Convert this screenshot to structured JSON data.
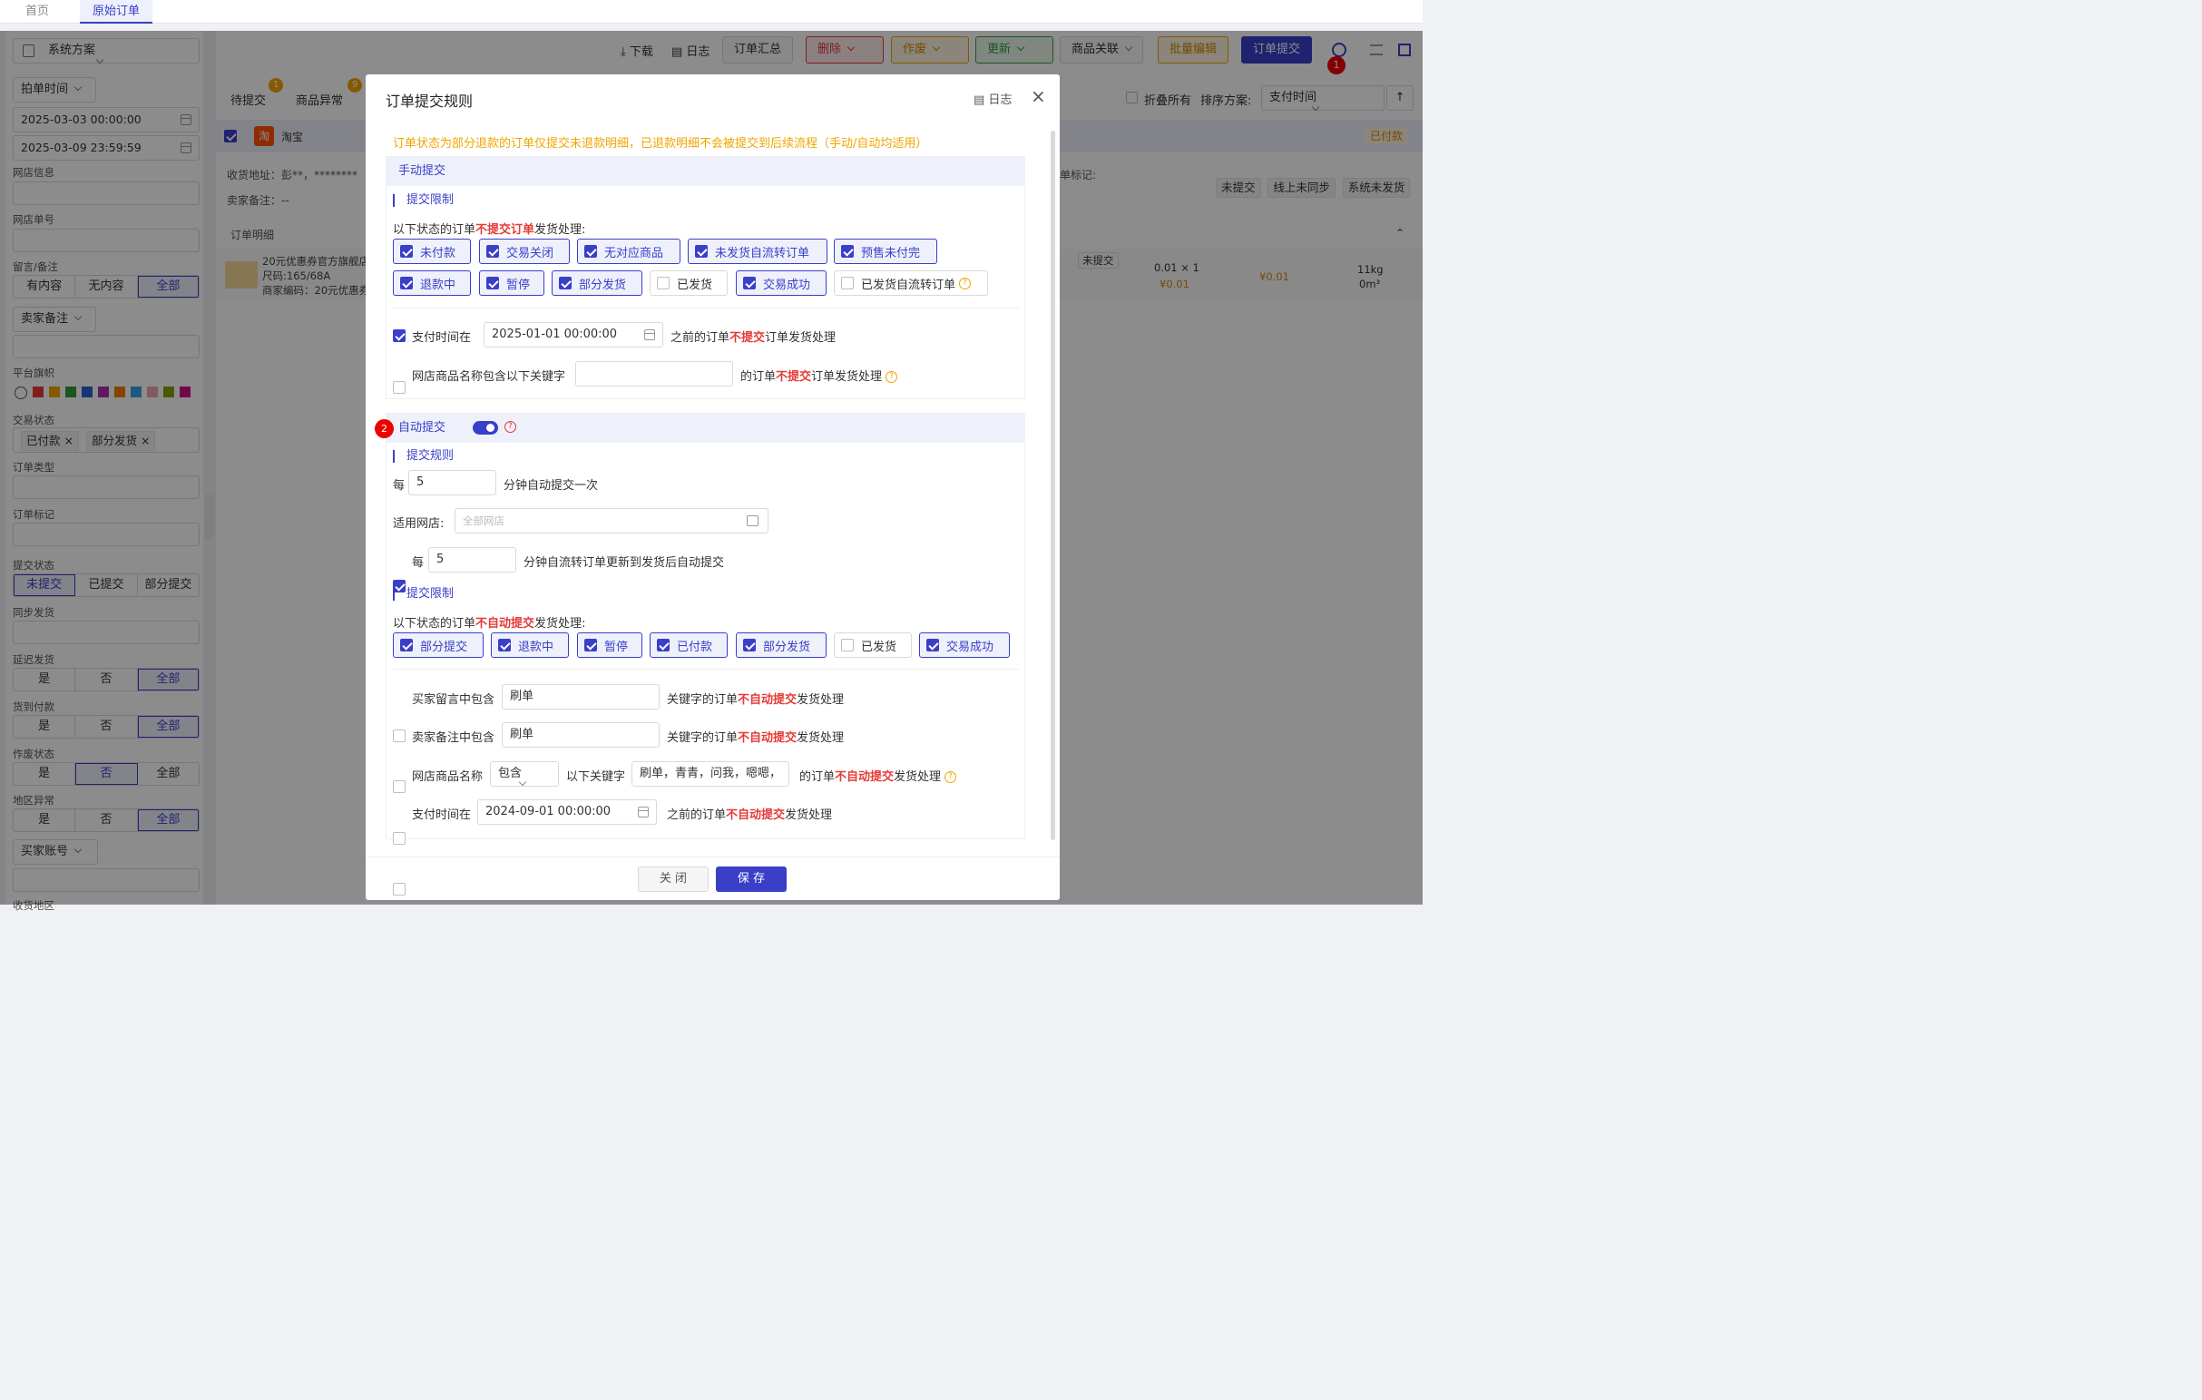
{
  "topnav": {
    "tabs": [
      "首页",
      "原始订单"
    ]
  },
  "sidebar": {
    "scheme": "系统方案",
    "time_type": "拍单时间",
    "start_time": "2025-03-03 00:00:00",
    "end_time": "2025-03-09 23:59:59",
    "shop_info_label": "网店信息",
    "shop_order_label": "网店单号",
    "message_label": "留言/备注",
    "message_options": [
      "有内容",
      "无内容",
      "全部"
    ],
    "seller_note": "卖家备注",
    "flag_label": "平台旗帜",
    "trade_status_label": "交易状态",
    "trade_status_tags": [
      "已付款",
      "部分发货"
    ],
    "order_type_label": "订单类型",
    "order_mark_label": "订单标记",
    "submit_status_label": "提交状态",
    "submit_options": [
      "未提交",
      "已提交",
      "部分提交"
    ],
    "sync_label": "同步发货",
    "delay_label": "延迟发货",
    "cod_label": "货到付款",
    "void_label": "作废状态",
    "region_label": "地区异常",
    "yes_no_all": [
      "是",
      "否",
      "全部"
    ],
    "buyer_account": "买家账号",
    "bottom_label": "收货地区"
  },
  "toolbar": {
    "download": "下载",
    "log": "日志",
    "summary": "订单汇总",
    "delete": "删除",
    "void": "作废",
    "update": "更新",
    "relate": "商品关联",
    "batch_edit": "批量编辑",
    "submit": "订单提交",
    "badge1": "1"
  },
  "main": {
    "tabs": [
      {
        "label": "待提交",
        "badge": "1"
      },
      {
        "label": "商品异常",
        "badge": "9"
      }
    ],
    "fold_all": "折叠所有",
    "sort_label": "排序方案:",
    "sort_value": "支付时间",
    "platform": "淘宝",
    "platform_icon": "淘",
    "paid_status": "已付款",
    "address": "收货地址：彭**，********",
    "seller_note": "卖家备注：--",
    "order_mark": "单标记:",
    "mark_tags": [
      "未提交",
      "线上未同步",
      "系统未发货"
    ],
    "detail_label": "订单明细",
    "item_name": "20元优惠券官方旗舰店",
    "item_size": "尺码:165/68A",
    "item_code": "商家编码：20元优惠券",
    "item_status": "未提交",
    "qty_price": "0.01 × 1",
    "price1": "¥0.01",
    "price2": "¥0.01",
    "weight": "11kg",
    "volume": "0m³"
  },
  "modal": {
    "title": "订单提交规则",
    "log": "日志",
    "notice": "订单状态为部分退款的订单仅提交未退款明细，已退款明细不会被提交到后续流程（手动/自动均适用）",
    "manual": {
      "header": "手动提交",
      "limit_title": "提交限制",
      "desc_pre": "以下状态的订单",
      "desc_red": "不提交订单",
      "desc_post": "发货处理:",
      "statuses_row1": [
        {
          "label": "未付款",
          "checked": true
        },
        {
          "label": "交易关闭",
          "checked": true
        },
        {
          "label": "无对应商品",
          "checked": true
        },
        {
          "label": "未发货自流转订单",
          "checked": true
        },
        {
          "label": "预售未付完",
          "checked": true
        }
      ],
      "statuses_row2": [
        {
          "label": "退款中",
          "checked": true
        },
        {
          "label": "暂停",
          "checked": true
        },
        {
          "label": "部分发货",
          "checked": true
        },
        {
          "label": "已发货",
          "checked": false
        },
        {
          "label": "交易成功",
          "checked": true
        },
        {
          "label": "已发货自流转订单",
          "checked": false
        }
      ],
      "pay_time_label": "支付时间在",
      "pay_time_value": "2025-01-01 00:00:00",
      "pay_time_suffix_pre": "之前的订单",
      "pay_time_suffix_red": "不提交",
      "pay_time_suffix_post": "订单发货处理",
      "keyword_label": "网店商品名称包含以下关键字",
      "keyword_suffix_pre": "的订单",
      "keyword_suffix_red": "不提交",
      "keyword_suffix_post": "订单发货处理"
    },
    "auto": {
      "badge": "2",
      "header": "自动提交",
      "rule_title": "提交规则",
      "every": "每",
      "interval": "5",
      "interval_suffix": "分钟自动提交一次",
      "shop_label": "适用网店:",
      "shop_placeholder": "全部网店",
      "flow_every": "每",
      "flow_interval": "5",
      "flow_suffix": "分钟自流转订单更新到发货后自动提交",
      "limit_title": "提交限制",
      "desc_pre": "以下状态的订单",
      "desc_red": "不自动提交",
      "desc_post": "发货处理:",
      "statuses": [
        {
          "label": "部分提交",
          "checked": true
        },
        {
          "label": "退款中",
          "checked": true
        },
        {
          "label": "暂停",
          "checked": true
        },
        {
          "label": "已付款",
          "checked": true
        },
        {
          "label": "部分发货",
          "checked": true
        },
        {
          "label": "已发货",
          "checked": false
        },
        {
          "label": "交易成功",
          "checked": true
        }
      ],
      "buyer_msg_label": "买家留言中包含",
      "buyer_msg_value": "刷单",
      "seller_note_label": "卖家备注中包含",
      "seller_note_value": "刷单",
      "kw_suffix_pre": "关键字的订单",
      "kw_suffix_red": "不自动提交",
      "kw_suffix_post": "发货处理",
      "name_label": "网店商品名称",
      "name_mode": "包含",
      "name_kw_label": "以下关键字",
      "name_kw_value": "刷单，青青，问我，嗯嗯，",
      "name_suffix_pre": "的订单",
      "name_suffix_red": "不自动提交",
      "name_suffix_post": "发货处理",
      "pay_label": "支付时间在",
      "pay_value": "2024-09-01 00:00:00",
      "pay_suffix_pre": "之前的订单",
      "pay_suffix_red": "不自动提交",
      "pay_suffix_post": "发货处理"
    },
    "close_btn": "关 闭",
    "save_btn": "保 存"
  },
  "colors": {
    "primary": "#3a3fc8",
    "danger": "#e53935",
    "warning": "#f0a500",
    "success": "#2e9e3a"
  }
}
